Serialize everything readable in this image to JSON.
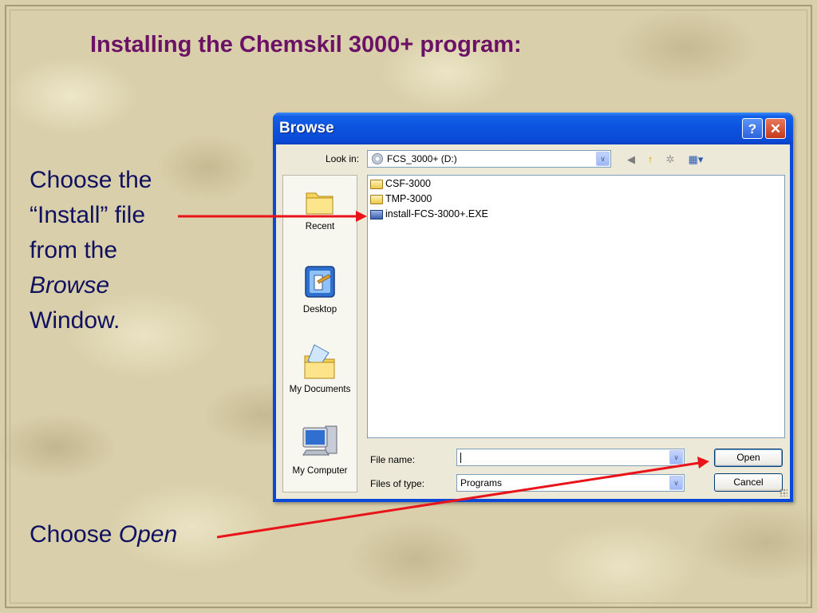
{
  "slide": {
    "title": "Installing the Chemskil 3000+ program:",
    "caption_install": {
      "line1": "Choose the",
      "line2": "“Install” file",
      "line3": "from the",
      "line4": "Browse",
      "line5": "Window."
    },
    "caption_open": {
      "prefix": "Choose",
      "emphasis": "Open"
    },
    "arrow_color": "#e8141a",
    "title_color": "#6b1166",
    "caption_color": "#101060"
  },
  "dialog": {
    "title": "Browse",
    "help_glyph": "?",
    "close_glyph": "✕",
    "look_in": {
      "label": "Look in:",
      "value": "FCS_3000+ (D:)"
    },
    "toolbar": {
      "back_glyph": "◀",
      "up_glyph": "↑",
      "new_folder_glyph": "✲",
      "view_glyph": "▦▾"
    },
    "places": [
      {
        "label": "Recent",
        "icon": "recent-folder-icon"
      },
      {
        "label": "Desktop",
        "icon": "desktop-icon"
      },
      {
        "label": "My Documents",
        "icon": "my-documents-icon"
      },
      {
        "label": "My Computer",
        "icon": "my-computer-icon"
      }
    ],
    "files": [
      {
        "name": "CSF-3000",
        "icon": "folder-icon"
      },
      {
        "name": "TMP-3000",
        "icon": "folder-icon"
      },
      {
        "name": "install-FCS-3000+.EXE",
        "icon": "exe-icon"
      }
    ],
    "file_name": {
      "label": "File name:",
      "value": ""
    },
    "file_type": {
      "label": "Files of type:",
      "value": "Programs"
    },
    "buttons": {
      "open": "Open",
      "cancel": "Cancel"
    },
    "dropdown_glyph": "∨"
  }
}
